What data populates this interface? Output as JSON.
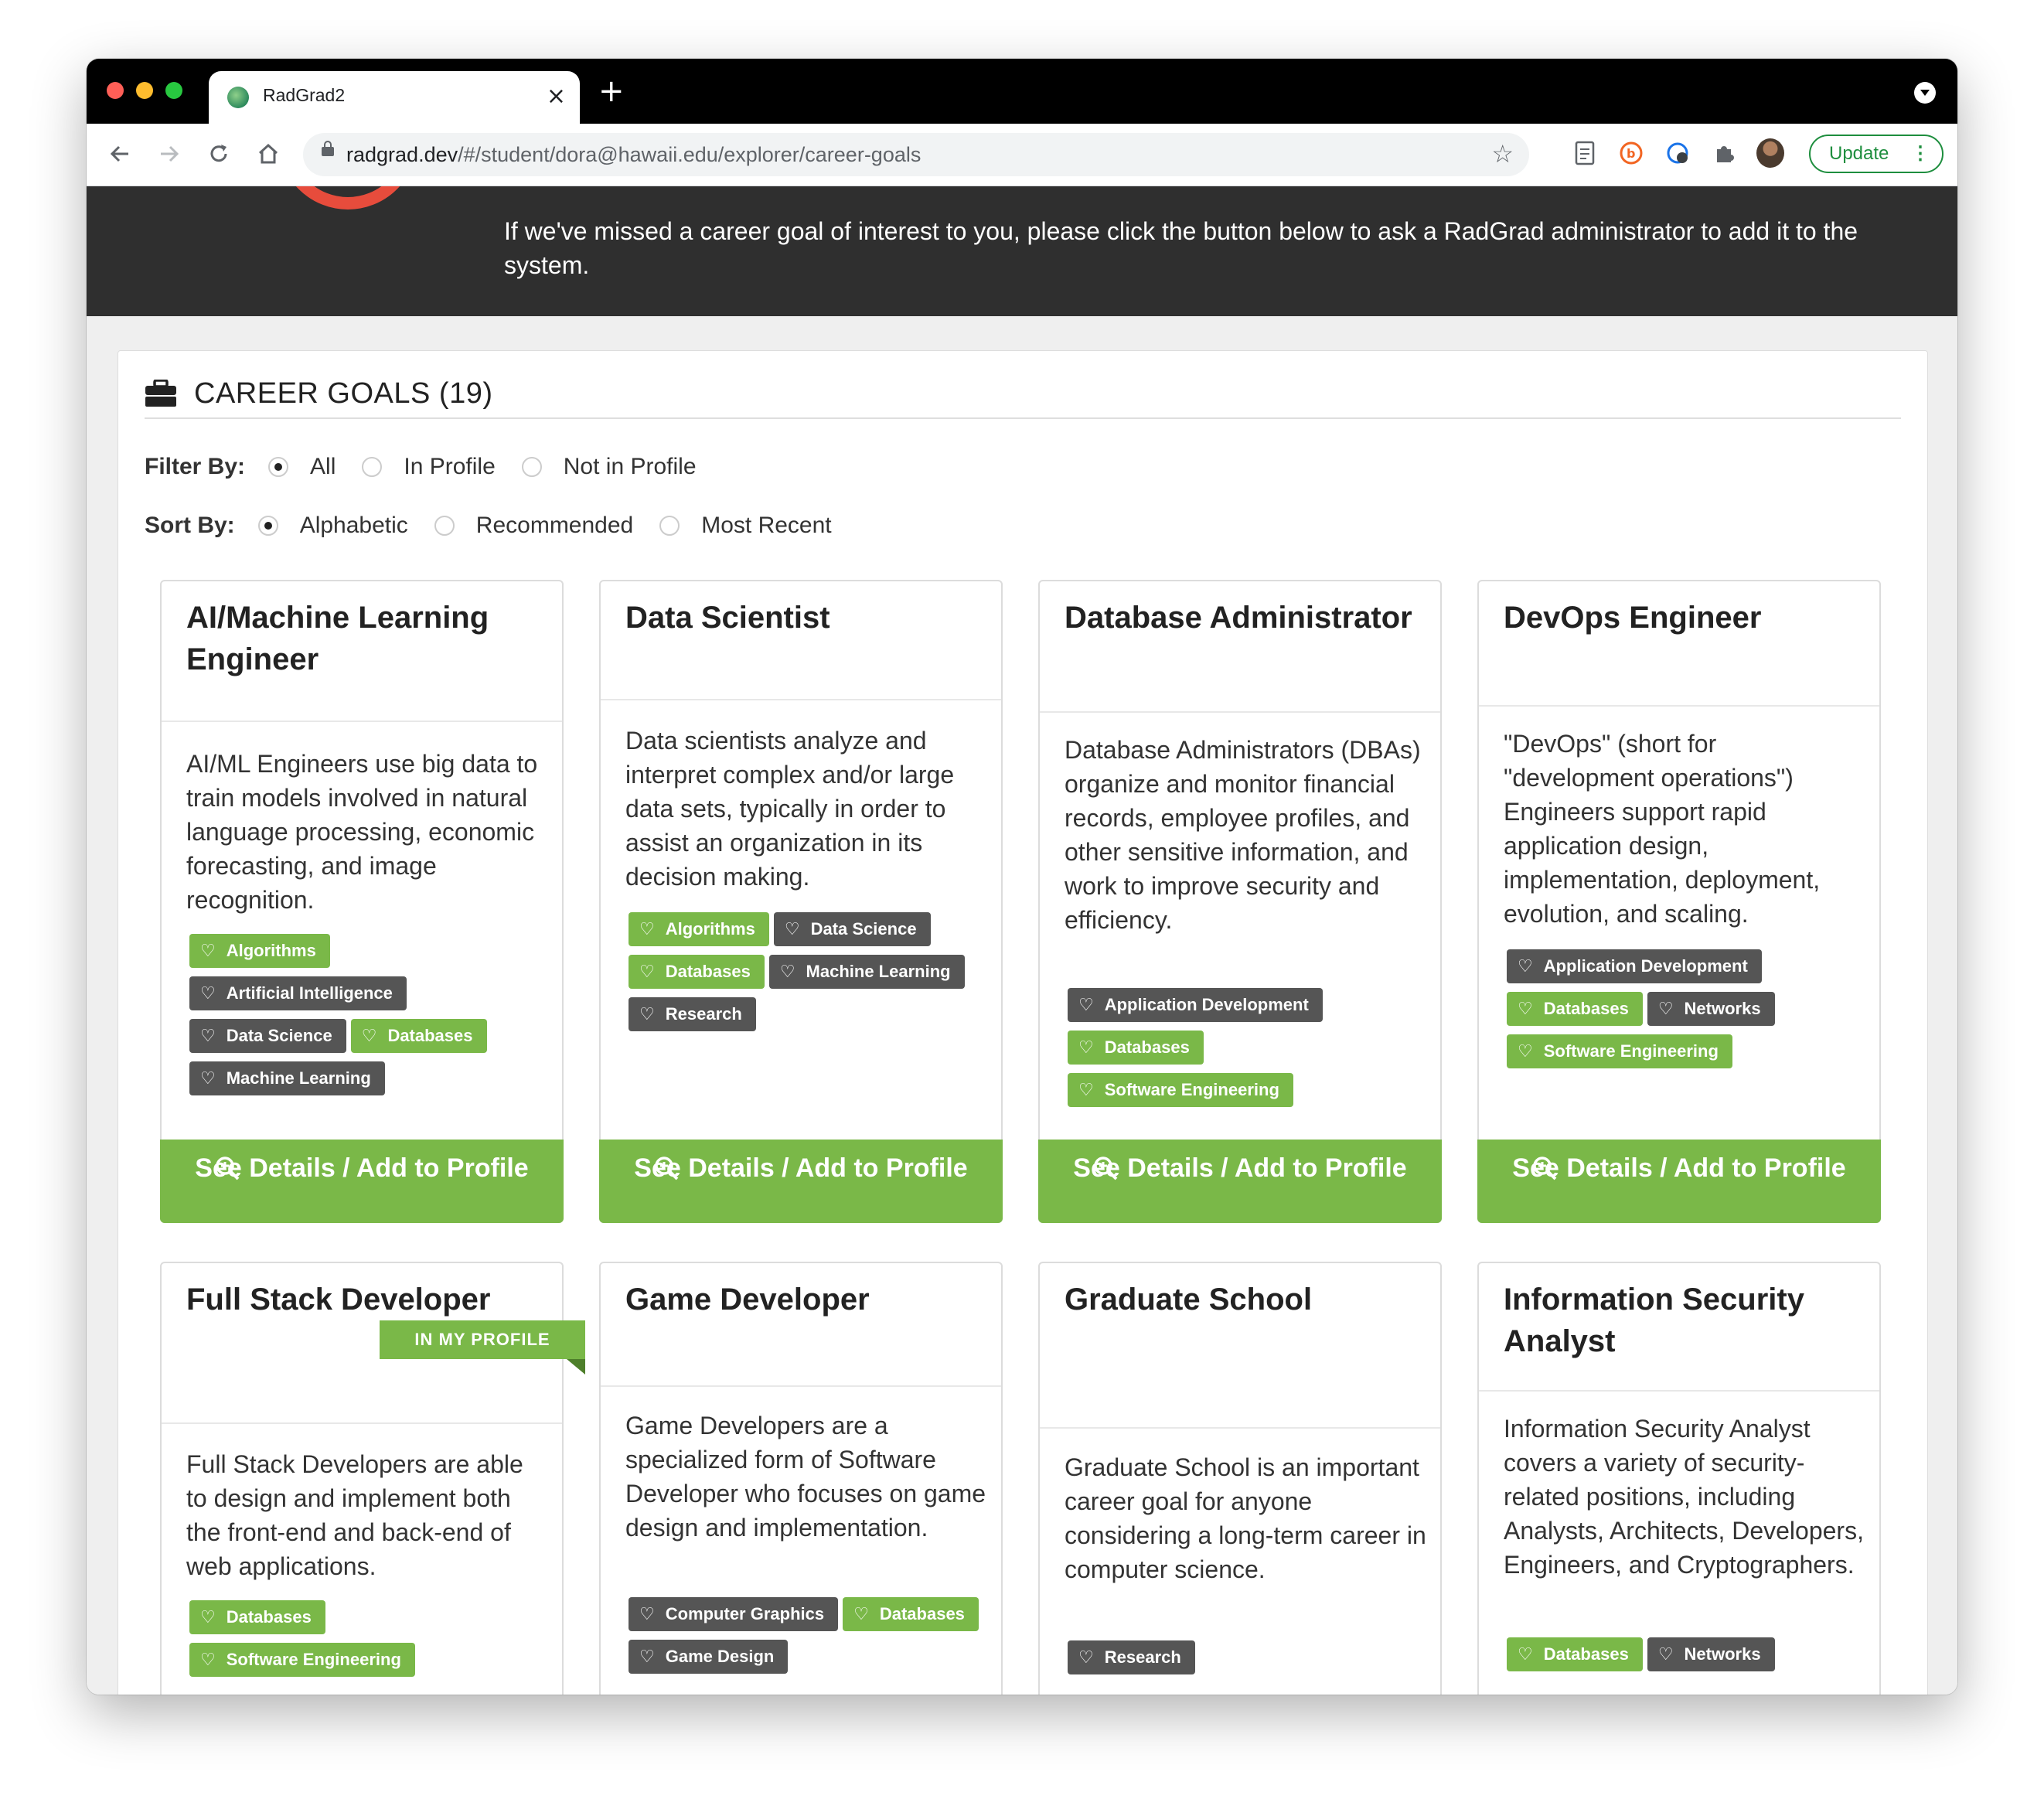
{
  "browser": {
    "tab_title": "RadGrad2",
    "tab_close": "×",
    "new_tab": "+",
    "url_host": "radgrad.dev",
    "url_path": "/#/student/dora@hawaii.edu/explorer/career-goals",
    "update_label": "Update",
    "menu_glyph": "⋮"
  },
  "banner": {
    "text": "If we've missed a career goal of interest to you, please click the button below to ask a RadGrad administrator to add it to the system."
  },
  "panel": {
    "icon": "briefcase-icon",
    "title": "CAREER GOALS (19)"
  },
  "filter": {
    "label": "Filter By:",
    "options": [
      "All",
      "In Profile",
      "Not in Profile"
    ],
    "selected": "All"
  },
  "sort": {
    "label": "Sort By:",
    "options": [
      "Alphabetic",
      "Recommended",
      "Most Recent"
    ],
    "selected": "Alphabetic"
  },
  "button_label": "See Details / Add to Profile",
  "colors": {
    "accent_green": "#7ab848",
    "tag_dark": "#555555",
    "banner": "#2f2f2f"
  },
  "cards": [
    {
      "title": "AI/Machine Learning Engineer",
      "description": "AI/ML Engineers use big data to train models involved in natural language processing, economic forecasting, and image recognition.",
      "tags": [
        {
          "label": "Algorithms",
          "style": "green"
        },
        {
          "label": "Artificial Intelligence",
          "style": "dark"
        },
        {
          "label": "Data Science",
          "style": "dark"
        },
        {
          "label": "Databases",
          "style": "green"
        },
        {
          "label": "Machine Learning",
          "style": "dark"
        }
      ]
    },
    {
      "title": "Data Scientist",
      "description": "Data scientists analyze and interpret complex and/or large data sets, typically in order to assist an organization in its decision making.",
      "tags": [
        {
          "label": "Algorithms",
          "style": "green"
        },
        {
          "label": "Data Science",
          "style": "dark"
        },
        {
          "label": "Databases",
          "style": "green"
        },
        {
          "label": "Machine Learning",
          "style": "dark"
        },
        {
          "label": "Research",
          "style": "dark"
        }
      ]
    },
    {
      "title": "Database Administrator",
      "description": "Database Administrators (DBAs) organize and monitor financial records, employee profiles, and other sensitive information, and work to improve security and efficiency.",
      "tags": [
        {
          "label": "Application Development",
          "style": "dark"
        },
        {
          "label": "Databases",
          "style": "green"
        },
        {
          "label": "Software Engineering",
          "style": "green"
        }
      ]
    },
    {
      "title": "DevOps Engineer",
      "description": "\"DevOps\" (short for \"development operations\") Engineers support rapid application design, implementation, deployment, evolution, and scaling.",
      "tags": [
        {
          "label": "Application Development",
          "style": "dark"
        },
        {
          "label": "Databases",
          "style": "green"
        },
        {
          "label": "Networks",
          "style": "dark"
        },
        {
          "label": "Software Engineering",
          "style": "green"
        }
      ]
    },
    {
      "title": "Full Stack Developer",
      "ribbon": "IN MY PROFILE",
      "description": "Full Stack Developers are able to design and implement both the front-end and back-end of web applications.",
      "tags": [
        {
          "label": "Databases",
          "style": "green"
        },
        {
          "label": "Software Engineering",
          "style": "green"
        }
      ]
    },
    {
      "title": "Game Developer",
      "description": "Game Developers are a specialized form of Software Developer who focuses on game design and implementation.",
      "tags": [
        {
          "label": "Computer Graphics",
          "style": "dark"
        },
        {
          "label": "Databases",
          "style": "green"
        },
        {
          "label": "Game Design",
          "style": "dark"
        }
      ]
    },
    {
      "title": "Graduate School",
      "description": "Graduate School is an important career goal for anyone considering a long-term career in computer science.",
      "tags": [
        {
          "label": "Research",
          "style": "dark"
        }
      ]
    },
    {
      "title": "Information Security Analyst",
      "description": "Information Security Analyst covers a variety of security-related positions, including Analysts, Architects, Developers, Engineers, and Cryptographers.",
      "tags": [
        {
          "label": "Databases",
          "style": "green"
        },
        {
          "label": "Networks",
          "style": "dark"
        }
      ]
    }
  ]
}
